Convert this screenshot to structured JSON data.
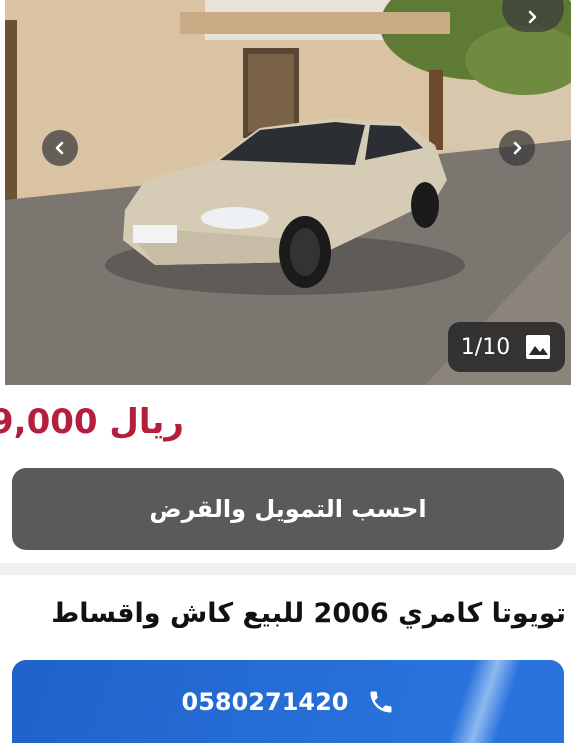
{
  "gallery": {
    "counter": "1/10",
    "prev_icon": "chevron-left-icon",
    "next_icon": "chevron-right-icon",
    "image_icon": "image-icon"
  },
  "listing": {
    "price": "9,000 ريال",
    "title": "تويوتا كامري 2006 للبيع كاش واقساط"
  },
  "actions": {
    "finance_label": "احسب التمويل والقرض",
    "phone": "0580271420",
    "phone_icon": "phone-icon"
  },
  "colors": {
    "price": "#b31f3c",
    "finance_button": "#5a5a5a",
    "call_button": "#2a73dd"
  }
}
